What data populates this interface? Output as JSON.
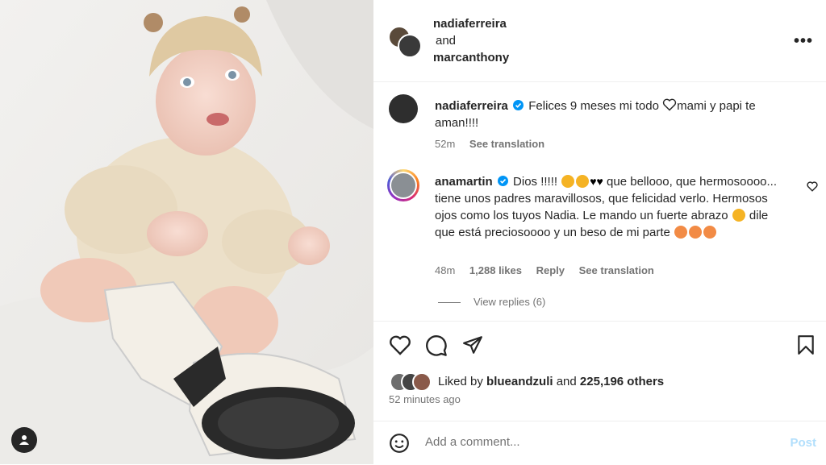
{
  "header": {
    "user1": "nadiaferreira",
    "and": "and",
    "user2": "marcanthony",
    "more_icon": "more-dots-icon"
  },
  "caption": {
    "user": "nadiaferreira",
    "text_1": "Felices 9 meses mi todo",
    "text_2": "mami y papi te aman!!!!",
    "time": "52m",
    "see_translation": "See translation"
  },
  "comment": {
    "user": "anamartin",
    "text_1": "Dios !!!!!",
    "text_2": "que bellooo, que hermosoooo... tiene unos padres maravillosos, que felicidad verlo. Hermosos ojos como los tuyos Nadia. Le mando un fuerte abrazo",
    "text_3": "dile que está preciosoooo y un beso de mi parte",
    "time": "48m",
    "likes": "1,288 likes",
    "reply": "Reply",
    "see_translation": "See translation"
  },
  "replies": {
    "label": "View replies (6)"
  },
  "likes": {
    "prefix": "Liked by",
    "user": "blueandzuli",
    "mid": "and",
    "count": "225,196 others"
  },
  "timestamp": "52 minutes ago",
  "comment_box": {
    "placeholder": "Add a comment...",
    "post": "Post"
  },
  "colors": {
    "link": "#0095f6",
    "muted": "#737373",
    "post_disabled": "#b2dffc"
  }
}
